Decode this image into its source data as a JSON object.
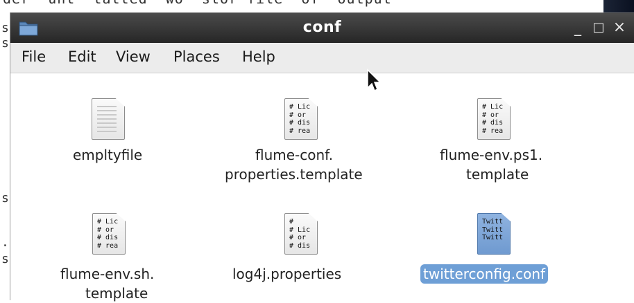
{
  "window": {
    "title": "conf",
    "title_icon": "folder-icon",
    "controls": {
      "minimize": "_",
      "maximize": "□",
      "close": "×"
    }
  },
  "menu": {
    "items": [
      "File",
      "Edit",
      "View",
      "Places",
      "Help"
    ]
  },
  "files": [
    {
      "name": "empltyfile",
      "label_lines": [
        "empltyfile"
      ],
      "icon": "blank-document-icon",
      "preview": "",
      "selected": false
    },
    {
      "name": "flume-conf.properties.template",
      "label_lines": [
        "flume-conf.",
        "properties.template"
      ],
      "icon": "text-document-icon",
      "preview": "# Lic\n# or\n# dis\n# rea",
      "selected": false
    },
    {
      "name": "flume-env.ps1.template",
      "label_lines": [
        "flume-env.ps1.",
        "template"
      ],
      "icon": "text-document-icon",
      "preview": "# Lic\n# or\n# dis\n# rea",
      "selected": false
    },
    {
      "name": "flume-env.sh.template",
      "label_lines": [
        "flume-env.sh.",
        "template"
      ],
      "icon": "text-document-icon",
      "preview": "# Lic\n# or\n# dis\n# rea",
      "selected": false
    },
    {
      "name": "log4j.properties",
      "label_lines": [
        "log4j.properties"
      ],
      "icon": "text-document-icon",
      "preview": "#\n# Lic\n# or\n# dis",
      "selected": false
    },
    {
      "name": "twitterconfig.conf",
      "label_lines": [
        "twitterconfig.conf"
      ],
      "icon": "text-document-icon",
      "preview": "Twitt\nTwitt\nTwitt",
      "selected": true
    }
  ],
  "colors": {
    "titlebar": "#2e2e2e",
    "menubar": "#ececec",
    "selection": "#6e9fd6"
  }
}
